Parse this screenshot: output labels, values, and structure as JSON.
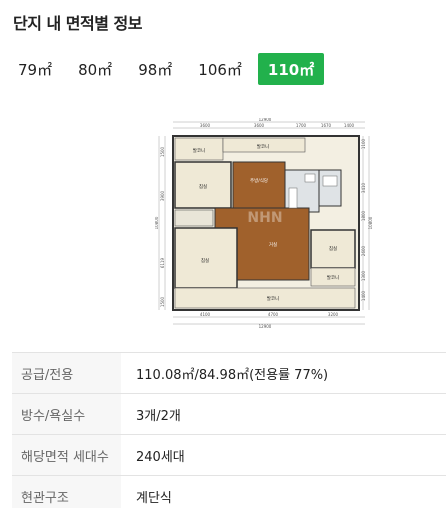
{
  "header": {
    "title": "단지 내 면적별 정보"
  },
  "tabs": [
    {
      "label": "79㎡"
    },
    {
      "label": "80㎡"
    },
    {
      "label": "98㎡"
    },
    {
      "label": "106㎡"
    },
    {
      "label": "110㎡",
      "active": true
    }
  ],
  "floorplan": {
    "watermark": "NHN",
    "rooms": [
      "발코니",
      "발코니",
      "주방/식당",
      "침실",
      "거실",
      "침실",
      "침실",
      "발코니",
      "발코니"
    ],
    "dims_top": [
      "12900",
      "3600",
      "3600",
      "1700",
      "1670",
      "1400"
    ],
    "dims_bottom": [
      "4100",
      "4700",
      "3200",
      "12900"
    ],
    "dims_left": [
      "1500",
      "3900",
      "6119",
      "1500"
    ],
    "dims_right": [
      "1100",
      "3410",
      "1800",
      "2600",
      "1300",
      "1400"
    ],
    "side_total": "10800"
  },
  "info": [
    {
      "label": "공급/전용",
      "value": "110.08㎡/84.98㎡(전용률 77%)"
    },
    {
      "label": "방수/욕실수",
      "value": "3개/2개"
    },
    {
      "label": "해당면적 세대수",
      "value": "240세대"
    },
    {
      "label": "현관구조",
      "value": "계단식"
    }
  ],
  "colors": {
    "accent": "#22b14c",
    "floor": "#a0612c",
    "room": "#efe9d6"
  }
}
